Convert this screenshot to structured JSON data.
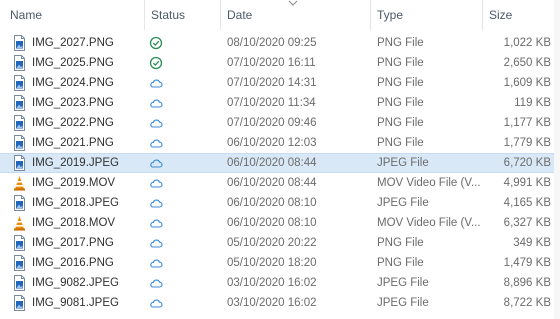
{
  "columns": {
    "name": "Name",
    "status": "Status",
    "date": "Date",
    "type": "Type",
    "size": "Size"
  },
  "files": [
    {
      "name": "IMG_2027.PNG",
      "icon": "png-file-icon",
      "status": "available-check-icon",
      "date": "08/10/2020 09:25",
      "type": "PNG File",
      "size": "1,022 KB",
      "selected": false
    },
    {
      "name": "IMG_2025.PNG",
      "icon": "png-file-icon",
      "status": "available-check-icon",
      "date": "07/10/2020 16:11",
      "type": "PNG File",
      "size": "2,650 KB",
      "selected": false
    },
    {
      "name": "IMG_2024.PNG",
      "icon": "png-file-icon",
      "status": "cloud-icon",
      "date": "07/10/2020 14:31",
      "type": "PNG File",
      "size": "1,609 KB",
      "selected": false
    },
    {
      "name": "IMG_2023.PNG",
      "icon": "png-file-icon",
      "status": "cloud-icon",
      "date": "07/10/2020 11:34",
      "type": "PNG File",
      "size": "119 KB",
      "selected": false
    },
    {
      "name": "IMG_2022.PNG",
      "icon": "png-file-icon",
      "status": "cloud-icon",
      "date": "07/10/2020 09:46",
      "type": "PNG File",
      "size": "1,177 KB",
      "selected": false
    },
    {
      "name": "IMG_2021.PNG",
      "icon": "png-file-icon",
      "status": "cloud-icon",
      "date": "06/10/2020 12:03",
      "type": "PNG File",
      "size": "1,779 KB",
      "selected": false
    },
    {
      "name": "IMG_2019.JPEG",
      "icon": "jpeg-file-icon",
      "status": "cloud-icon",
      "date": "06/10/2020 08:44",
      "type": "JPEG File",
      "size": "6,720 KB",
      "selected": true
    },
    {
      "name": "IMG_2019.MOV",
      "icon": "vlc-cone-icon",
      "status": "cloud-icon",
      "date": "06/10/2020 08:44",
      "type": "MOV Video File (V...",
      "size": "4,991 KB",
      "selected": false
    },
    {
      "name": "IMG_2018.JPEG",
      "icon": "jpeg-file-icon",
      "status": "cloud-icon",
      "date": "06/10/2020 08:10",
      "type": "JPEG File",
      "size": "4,165 KB",
      "selected": false
    },
    {
      "name": "IMG_2018.MOV",
      "icon": "vlc-cone-icon",
      "status": "cloud-icon",
      "date": "06/10/2020 08:10",
      "type": "MOV Video File (V...",
      "size": "6,327 KB",
      "selected": false
    },
    {
      "name": "IMG_2017.PNG",
      "icon": "png-file-icon",
      "status": "cloud-icon",
      "date": "05/10/2020 20:22",
      "type": "PNG File",
      "size": "349 KB",
      "selected": false
    },
    {
      "name": "IMG_2016.PNG",
      "icon": "png-file-icon",
      "status": "cloud-icon",
      "date": "05/10/2020 18:20",
      "type": "PNG File",
      "size": "1,479 KB",
      "selected": false
    },
    {
      "name": "IMG_9082.JPEG",
      "icon": "jpeg-file-icon",
      "status": "cloud-icon",
      "date": "03/10/2020 16:02",
      "type": "JPEG File",
      "size": "8,896 KB",
      "selected": false
    },
    {
      "name": "IMG_9081.JPEG",
      "icon": "jpeg-file-icon",
      "status": "cloud-icon",
      "date": "03/10/2020 16:02",
      "type": "JPEG File",
      "size": "8,722 KB",
      "selected": false
    }
  ],
  "colors": {
    "selected_bg": "#d9e8f7",
    "check_green": "#2e8b57",
    "cloud_blue": "#3a8ad8",
    "file_icon_blue": "#2266bb",
    "vlc_orange": "#f08a00"
  }
}
